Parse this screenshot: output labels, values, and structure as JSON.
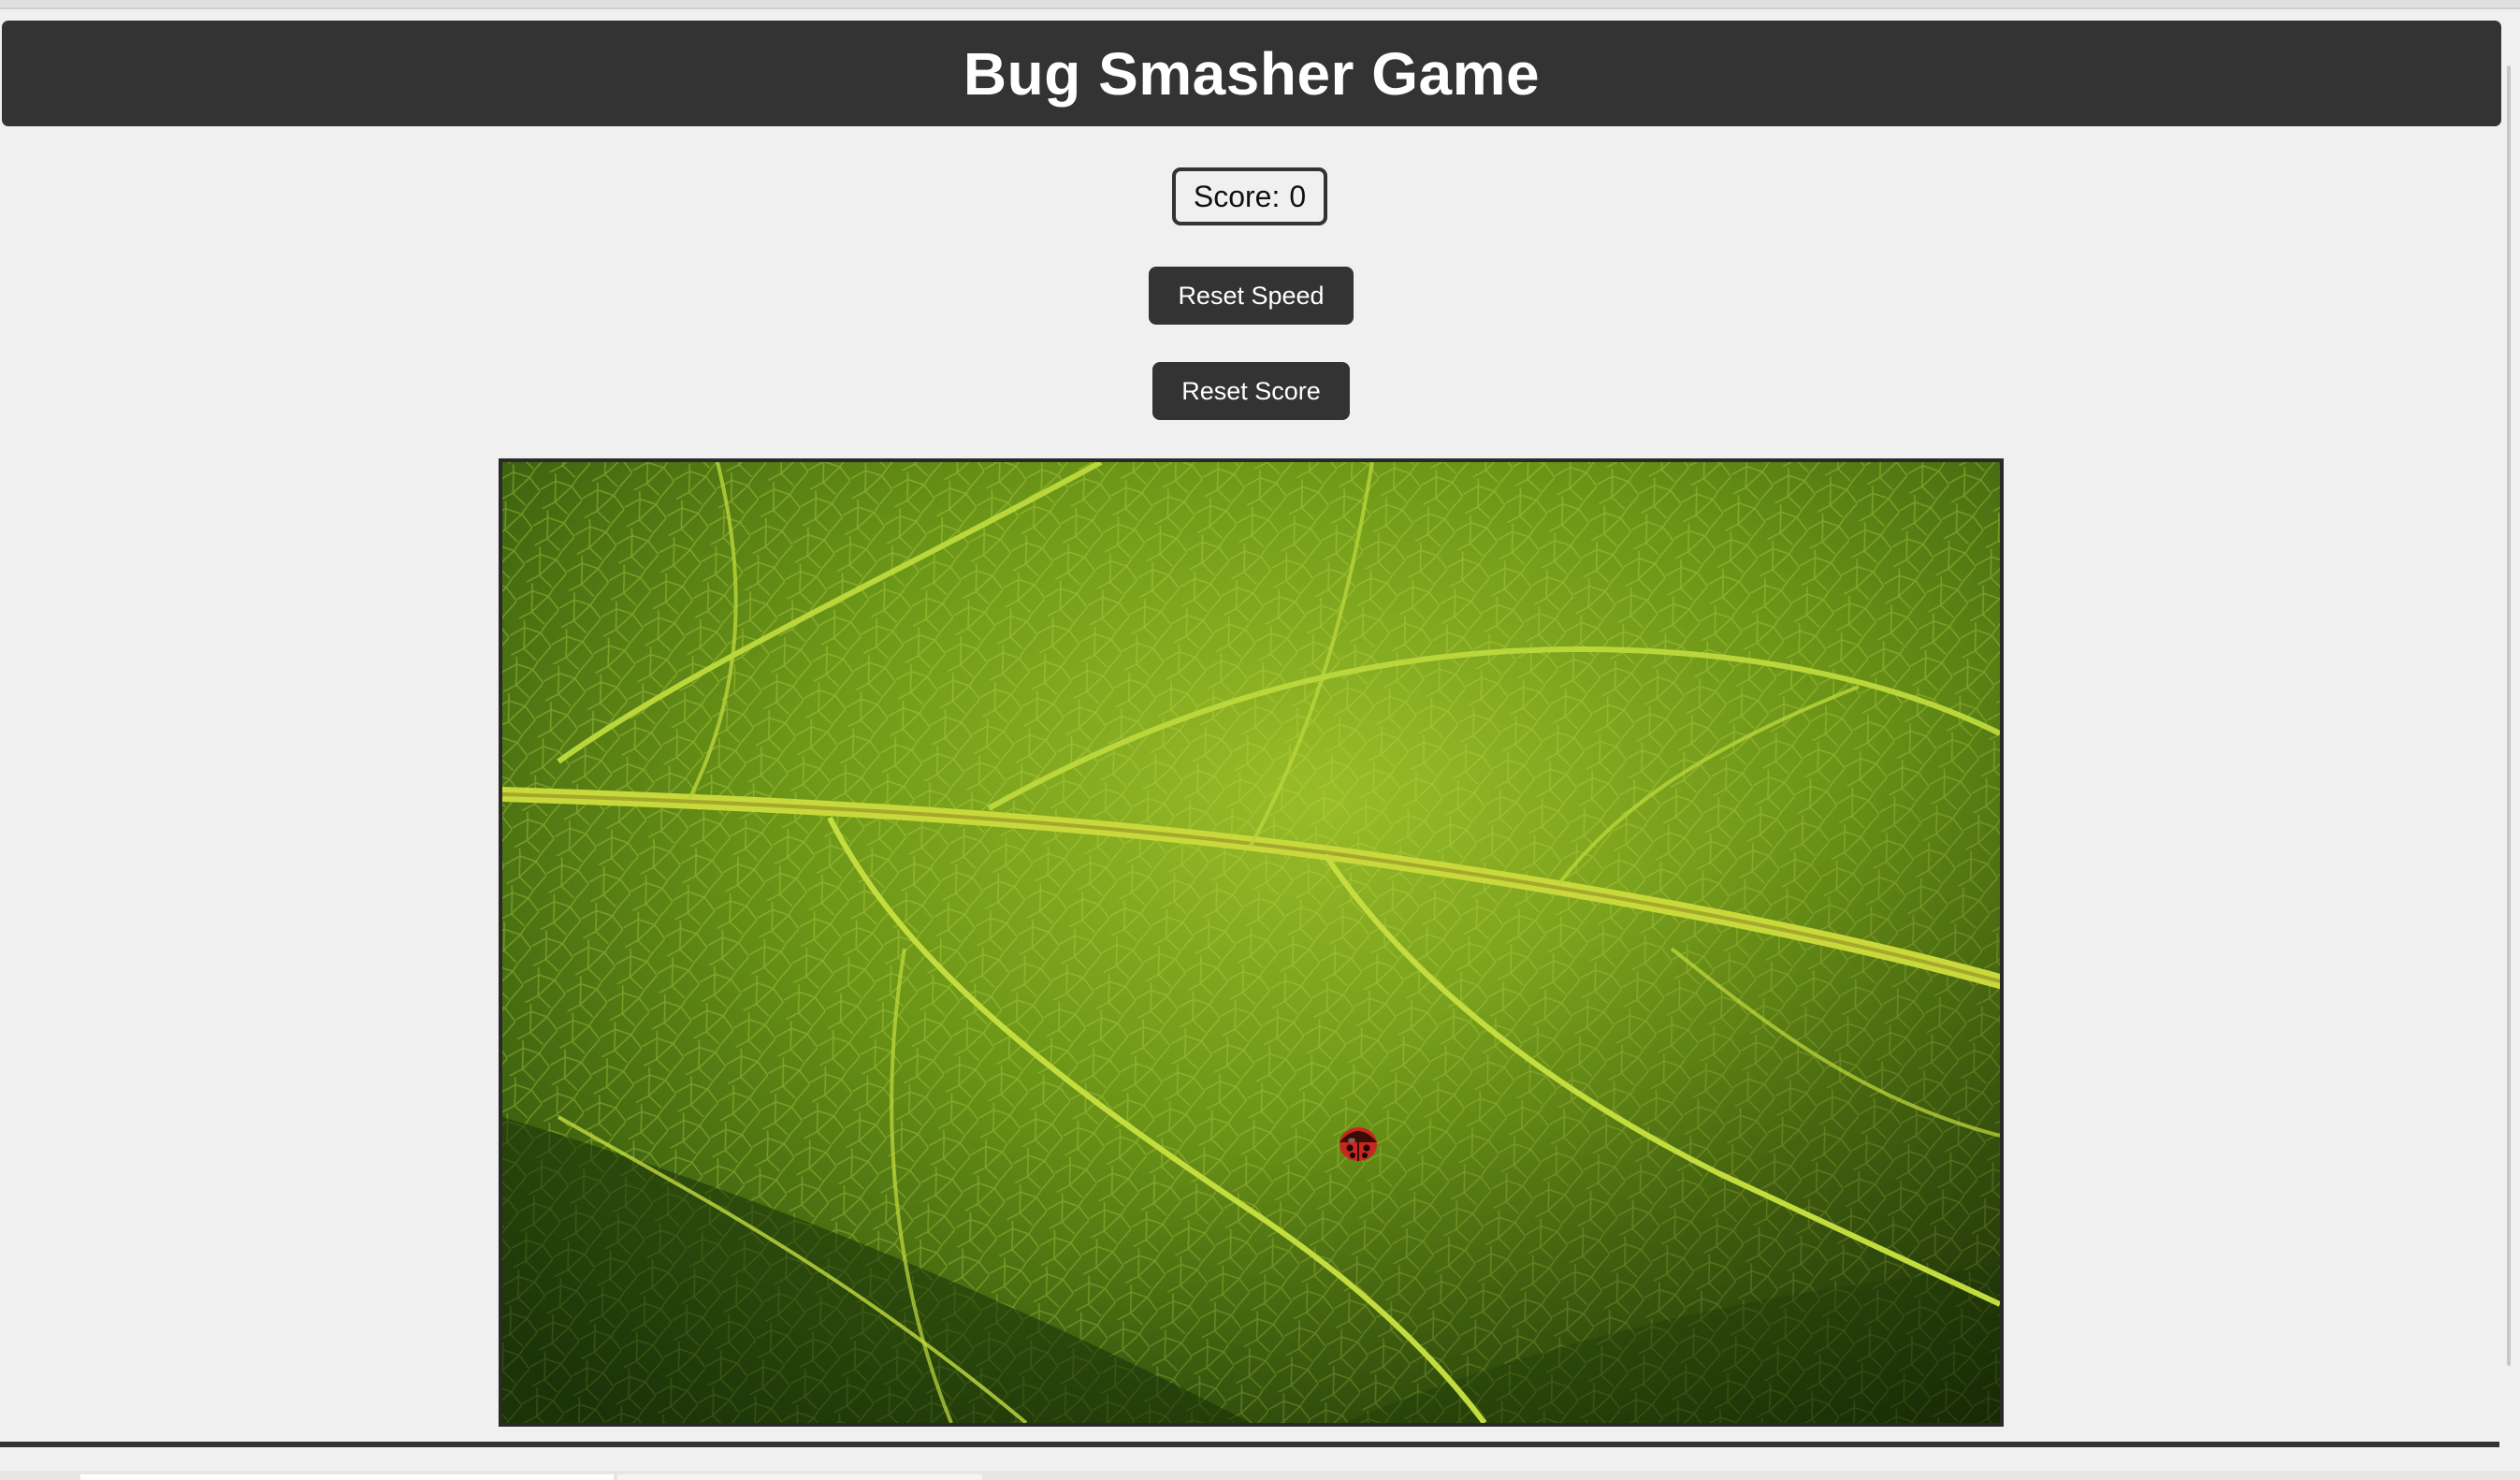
{
  "header": {
    "title": "Bug Smasher Game"
  },
  "score": {
    "label": "Score:",
    "value": "0"
  },
  "controls": {
    "reset_speed_label": "Reset Speed",
    "reset_score_label": "Reset Score"
  },
  "game_area": {
    "background": "green leaf close-up",
    "bug": "ladybug"
  },
  "colors": {
    "header_bg": "#333333",
    "button_bg": "#333333",
    "page_bg": "#f0f0f0",
    "leaf_green": "#6f9a1a",
    "ladybug_red": "#c8261e"
  }
}
